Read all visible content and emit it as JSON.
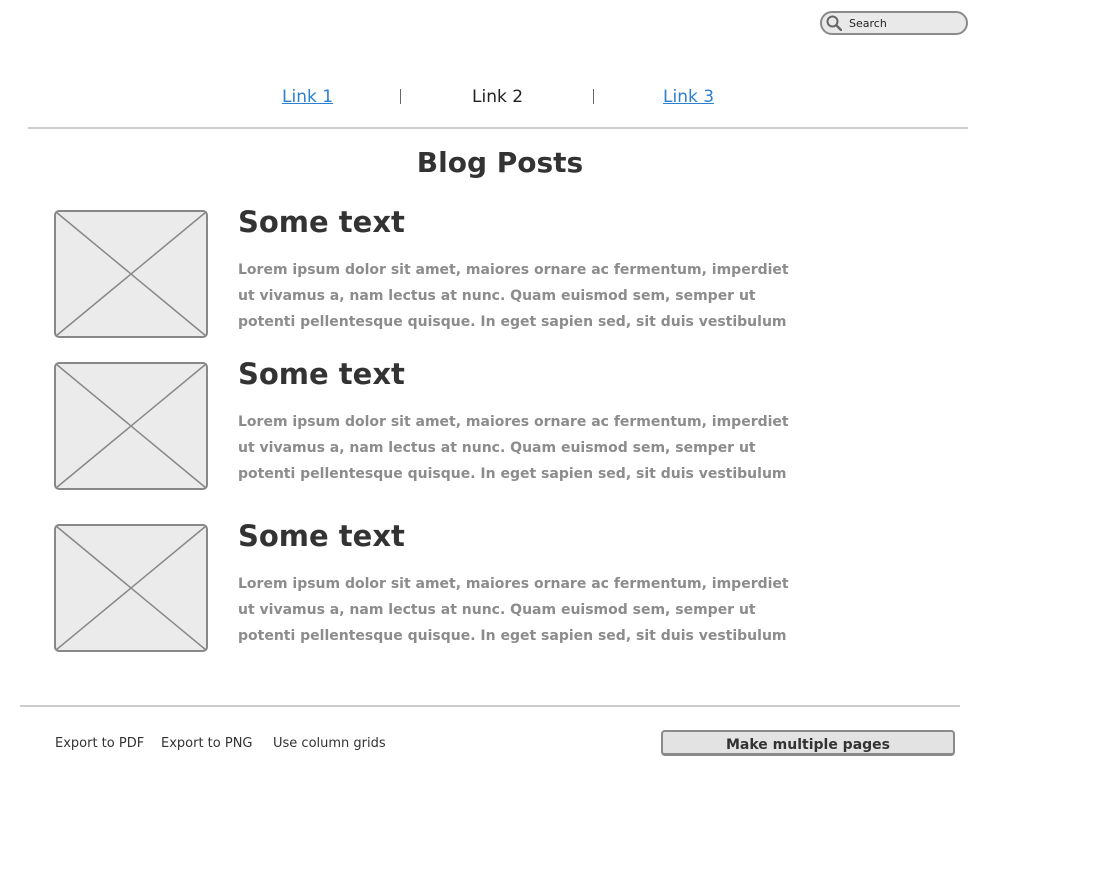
{
  "search": {
    "placeholder": "Search",
    "icon": "search-icon"
  },
  "nav": {
    "links": [
      {
        "label": "Link 1",
        "active": false
      },
      {
        "label": "Link 2",
        "active": true
      },
      {
        "label": "Link 3",
        "active": false
      }
    ],
    "separator": "|"
  },
  "page": {
    "title": "Blog Posts"
  },
  "posts": [
    {
      "title": "Some text",
      "image_icon": "image-placeholder-icon",
      "body_lines": [
        "Lorem ipsum dolor sit amet, maiores ornare ac fermentum, imperdiet",
        "ut vivamus a, nam lectus at nunc. Quam euismod sem, semper ut",
        "potenti pellentesque quisque. In eget sapien sed, sit duis vestibulum"
      ]
    },
    {
      "title": "Some text",
      "image_icon": "image-placeholder-icon",
      "body_lines": [
        "Lorem ipsum dolor sit amet, maiores ornare ac fermentum, imperdiet",
        "ut vivamus a, nam lectus at nunc. Quam euismod sem, semper ut",
        "potenti pellentesque quisque. In eget sapien sed, sit duis vestibulum"
      ]
    },
    {
      "title": "Some text",
      "image_icon": "image-placeholder-icon",
      "body_lines": [
        "Lorem ipsum dolor sit amet, maiores ornare ac fermentum, imperdiet",
        "ut vivamus a, nam lectus at nunc. Quam euismod sem, semper ut",
        "potenti pellentesque quisque. In eget sapien sed, sit duis vestibulum"
      ]
    }
  ],
  "footer": {
    "export_pdf": "Export to PDF",
    "export_png": "Export to PNG",
    "column_grids": "Use column grids",
    "make_pages": "Make multiple pages"
  },
  "colors": {
    "link": "#2d7fd0",
    "text": "#333333",
    "muted_text": "#8c8c8c",
    "placeholder_fill": "#ebebeb",
    "placeholder_stroke": "#888888"
  }
}
